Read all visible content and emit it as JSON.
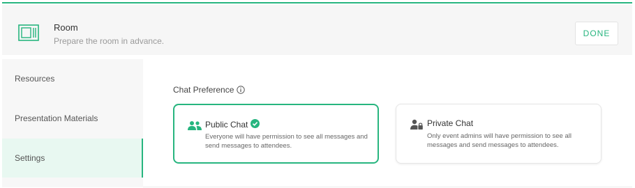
{
  "accent_color": "#27b57f",
  "header": {
    "icon": "room-layout-icon",
    "title": "Room",
    "subtitle": "Prepare the room in advance.",
    "done_label": "DONE"
  },
  "sidebar": {
    "items": [
      {
        "label": "Resources",
        "active": false
      },
      {
        "label": "Presentation Materials",
        "active": false
      },
      {
        "label": "Settings",
        "active": true
      }
    ]
  },
  "main": {
    "section_label": "Chat Preference",
    "section_icon": "info-icon",
    "options": [
      {
        "icon": "group-users-icon",
        "title": "Public Chat",
        "selected": true,
        "description": "Everyone will have permission to see all messages and send messages to attendees."
      },
      {
        "icon": "admin-lock-user-icon",
        "title": "Private Chat",
        "selected": false,
        "description": "Only event admins will have permission to see all messages and send messages to attendees."
      }
    ]
  }
}
